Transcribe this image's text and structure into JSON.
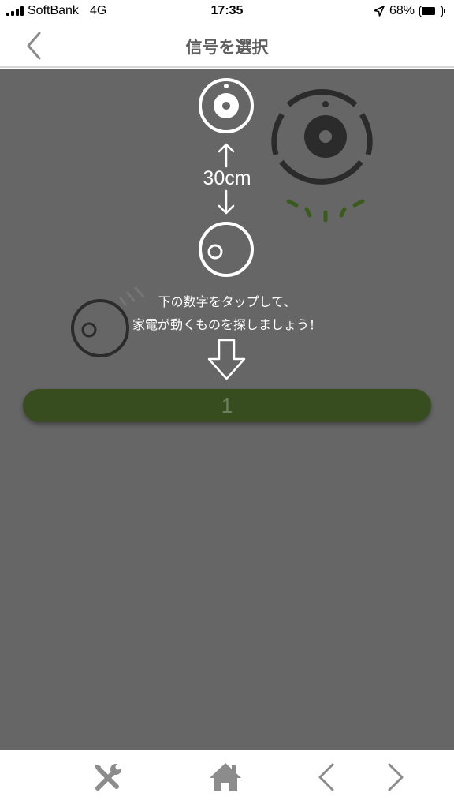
{
  "status_bar": {
    "carrier": "SoftBank",
    "network": "4G",
    "time": "17:35",
    "battery_percent": "68%",
    "battery_level": 0.68,
    "icons": [
      "signal-bars-icon",
      "location-arrow-icon",
      "battery-icon"
    ]
  },
  "nav": {
    "title": "信号を選択",
    "back_icon": "chevron-left-icon"
  },
  "main": {
    "distance_label": "30cm",
    "instruction_line1": "下の数字をタップして、",
    "instruction_line2": "家電が動くものを探しましょう！",
    "signal_button_label": "1",
    "colors": {
      "background": "#666666",
      "button": "#374d1f",
      "robot_dark": "#2b2b2b",
      "signal_dash": "#3c5a1e"
    }
  },
  "toolbar": {
    "icons": [
      "tools-icon",
      "home-icon",
      "chevron-left-icon",
      "chevron-right-icon"
    ]
  }
}
